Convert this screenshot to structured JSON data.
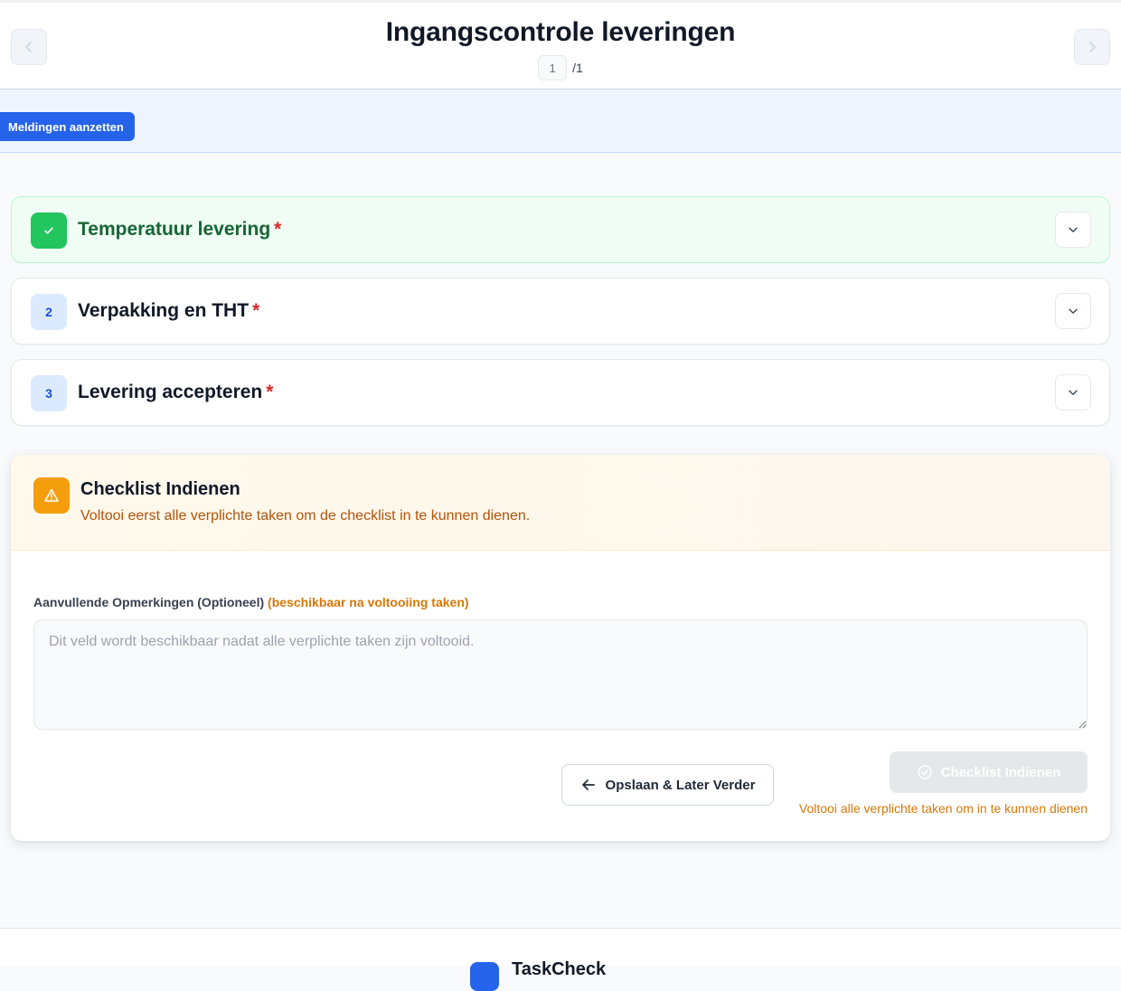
{
  "header": {
    "title": "Ingangscontrole leveringen",
    "current_page": "1",
    "total_pages": "/1"
  },
  "notifications": {
    "button_label": "Meldingen aanzetten"
  },
  "tasks": [
    {
      "number": "",
      "title": "Temperatuur levering",
      "required_mark": "*",
      "status": "completed"
    },
    {
      "number": "2",
      "title": "Verpakking en THT",
      "required_mark": "*",
      "status": "open"
    },
    {
      "number": "3",
      "title": "Levering accepteren",
      "required_mark": "*",
      "status": "open"
    }
  ],
  "submit_section": {
    "title": "Checklist Indienen",
    "warning": "Voltooi eerst alle verplichte taken om de checklist in te kunnen dienen.",
    "remarks_label": "Aanvullende Opmerkingen (Optioneel)",
    "remarks_hint": "(beschikbaar na voltooiing taken)",
    "remarks_placeholder": "Dit veld wordt beschikbaar nadat alle verplichte taken zijn voltooid.",
    "save_button": "Opslaan & Later Verder",
    "submit_button": "Checklist Indienen",
    "submit_hint": "Voltooi alle verplichte taken om in te kunnen dienen"
  },
  "footer": {
    "brand": "TaskCheck"
  },
  "colors": {
    "primary": "#2563eb",
    "success": "#22c55e",
    "warning": "#f59e0b",
    "required": "#dc2626"
  }
}
